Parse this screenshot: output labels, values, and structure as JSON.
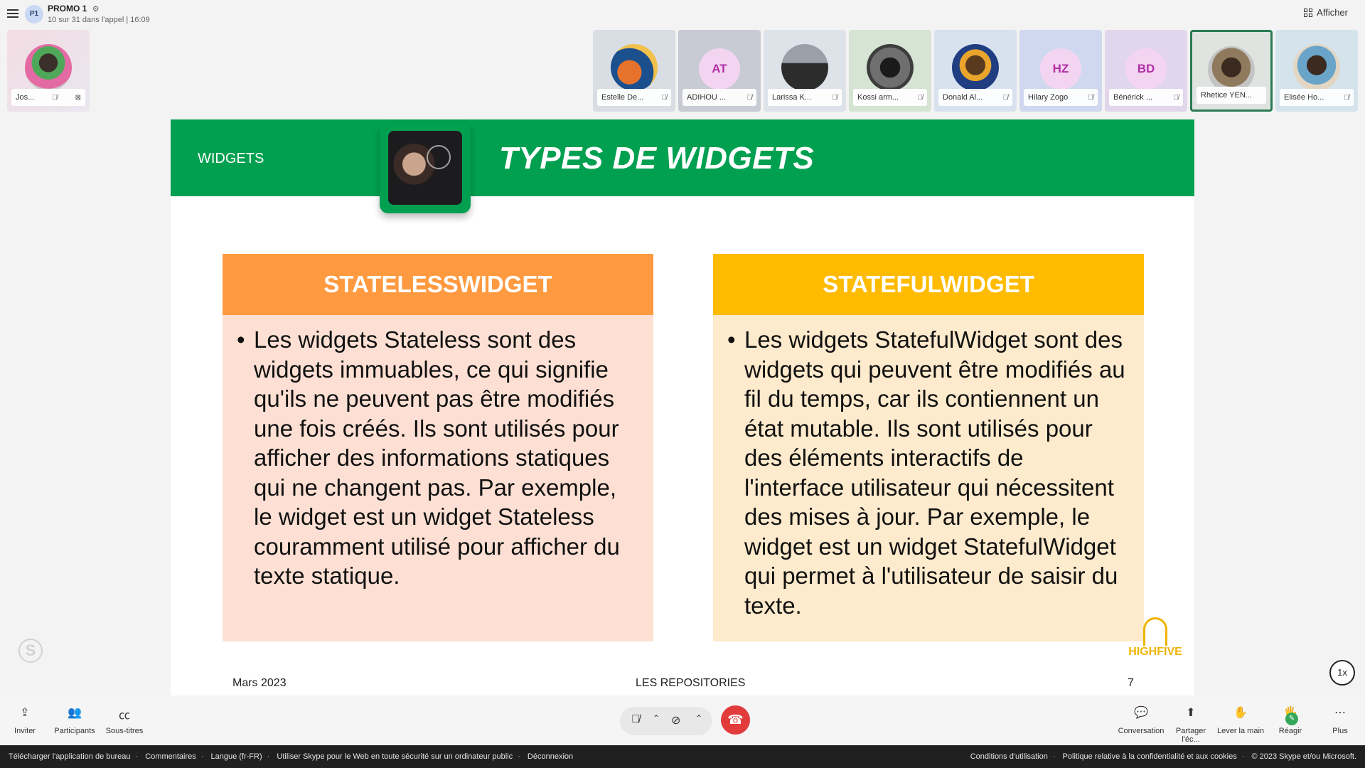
{
  "header": {
    "call_initials": "P1",
    "call_title": "PROMO 1",
    "call_subtitle": "10 sur 31 dans l'appel | 16:09",
    "show_label": "Afficher"
  },
  "self_tile": {
    "name": "Jos..."
  },
  "participants": [
    {
      "name": "Estelle De...",
      "initials": ""
    },
    {
      "name": "ADIHOU ...",
      "initials": "AT"
    },
    {
      "name": "Larissa K...",
      "initials": ""
    },
    {
      "name": "Kossi arm...",
      "initials": ""
    },
    {
      "name": "Donald Al...",
      "initials": ""
    },
    {
      "name": "Hilary Zogo",
      "initials": "HZ"
    },
    {
      "name": "Bénérick ...",
      "initials": "BD"
    },
    {
      "name": "Rhetice YEN...",
      "initials": ""
    },
    {
      "name": "Elisée Ho...",
      "initials": ""
    }
  ],
  "slide": {
    "section": "WIDGETS",
    "title": "TYPES DE WIDGETS",
    "left_box": {
      "heading": "STATELESSWIDGET",
      "text": "Les widgets Stateless sont des widgets immuables, ce qui signifie qu'ils ne peuvent pas être modifiés une fois créés. Ils sont utilisés pour afficher des informations statiques qui ne changent pas. Par exemple, le widget est un widget Stateless couramment utilisé pour afficher du texte statique."
    },
    "right_box": {
      "heading": "STATEFULWIDGET",
      "text": "Les widgets StatefulWidget sont des widgets qui peuvent être modifiés au fil du temps, car ils contiennent un état mutable. Ils sont utilisés pour des éléments interactifs de l'interface utilisateur qui nécessitent des mises à jour. Par exemple, le widget est un widget StatefulWidget qui permet à l'utilisateur de saisir du texte."
    },
    "footer_left": "Mars 2023",
    "footer_center": "LES REPOSITORIES",
    "footer_right": "7",
    "logo_text": "HIGHFIVE"
  },
  "speed_label": "1x",
  "toolbar": {
    "invite": "Inviter",
    "participants": "Participants",
    "subtitles": "Sous-titres",
    "conversation": "Conversation",
    "share": "Partager l'éc...",
    "raise_hand": "Lever la main",
    "react": "Réagir",
    "more": "Plus"
  },
  "footer": {
    "download": "Télécharger l'application de bureau",
    "comments": "Commentaires",
    "language": "Langue (fr-FR)",
    "safety": "Utiliser Skype pour le Web en toute sécurité sur un ordinateur public",
    "logout": "Déconnexion",
    "terms": "Conditions d'utilisation",
    "privacy": "Politique relative à la confidentialité et aux cookies",
    "copyright": "© 2023 Skype et/ou Microsoft."
  },
  "colors": {
    "slide_green": "#00a050",
    "stateless_orange": "#ff9a40",
    "stateful_yellow": "#ffbb00",
    "hangup_red": "#e23b3b"
  }
}
